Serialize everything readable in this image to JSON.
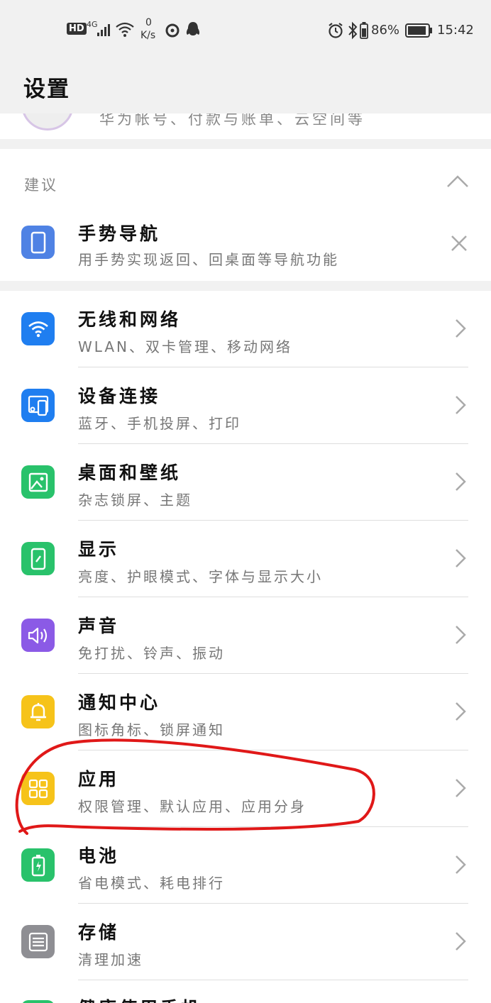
{
  "status_bar": {
    "hd": "HD",
    "network": "4G",
    "speed_value": "0",
    "speed_unit": "K/s",
    "battery_percent": "86%",
    "time": "15:42"
  },
  "header": {
    "title": "设置"
  },
  "account": {
    "subtitle": "华为帐号、付款与账单、云空间等"
  },
  "suggestions": {
    "title": "建议",
    "item": {
      "title": "手势导航",
      "subtitle": "用手势实现返回、回桌面等导航功能"
    }
  },
  "settings": [
    {
      "title": "无线和网络",
      "subtitle": "WLAN、双卡管理、移动网络",
      "icon": "wifi-icon",
      "color": "#1f7ef0"
    },
    {
      "title": "设备连接",
      "subtitle": "蓝牙、手机投屏、打印",
      "icon": "device-connection-icon",
      "color": "#1f7ef0"
    },
    {
      "title": "桌面和壁纸",
      "subtitle": "杂志锁屏、主题",
      "icon": "wallpaper-icon",
      "color": "#29c26b"
    },
    {
      "title": "显示",
      "subtitle": "亮度、护眼模式、字体与显示大小",
      "icon": "display-icon",
      "color": "#29c26b"
    },
    {
      "title": "声音",
      "subtitle": "免打扰、铃声、振动",
      "icon": "sound-icon",
      "color": "#8b5ae6"
    },
    {
      "title": "通知中心",
      "subtitle": "图标角标、锁屏通知",
      "icon": "bell-icon",
      "color": "#f6c31a"
    },
    {
      "title": "应用",
      "subtitle": "权限管理、默认应用、应用分身",
      "icon": "apps-icon",
      "color": "#f6c31a"
    },
    {
      "title": "电池",
      "subtitle": "省电模式、耗电排行",
      "icon": "battery-icon",
      "color": "#29c26b"
    },
    {
      "title": "存储",
      "subtitle": "清理加速",
      "icon": "storage-icon",
      "color": "#8e8e93"
    },
    {
      "title": "健康使用手机",
      "subtitle": "",
      "icon": "health-icon",
      "color": "#29c26b"
    }
  ]
}
